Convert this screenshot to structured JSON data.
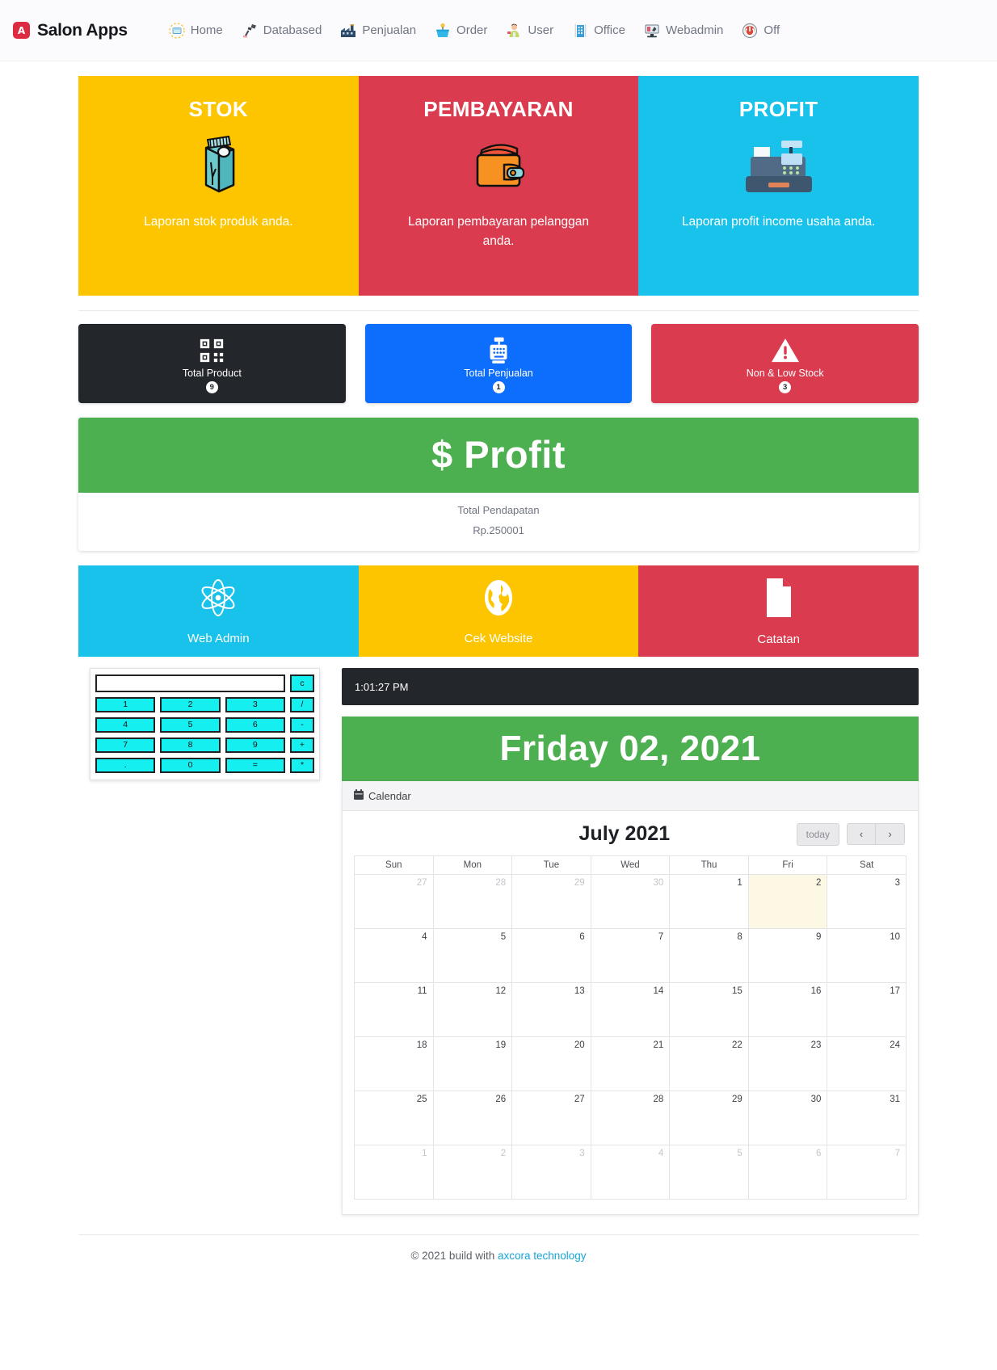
{
  "navbar": {
    "brand_initial": "A",
    "brand_name": "Salon Apps",
    "items": [
      {
        "label": "Home",
        "icon": "home-icon"
      },
      {
        "label": "Databased",
        "icon": "database-scanner-icon"
      },
      {
        "label": "Penjualan",
        "icon": "factory-icon"
      },
      {
        "label": "Order",
        "icon": "basket-icon"
      },
      {
        "label": "User",
        "icon": "user-icon"
      },
      {
        "label": "Office",
        "icon": "office-building-icon"
      },
      {
        "label": "Webadmin",
        "icon": "monitor-icon"
      },
      {
        "label": "Off",
        "icon": "power-off-icon"
      }
    ]
  },
  "hero_cards": [
    {
      "title": "STOK",
      "desc": "Laporan stok produk anda.",
      "color": "#fdc500",
      "icon": "milk-carton-icon"
    },
    {
      "title": "PEMBAYARAN",
      "desc": "Laporan pembayaran pelanggan anda.",
      "color": "#db3b4e",
      "icon": "wallet-icon"
    },
    {
      "title": "PROFIT",
      "desc": "Laporan profit income usaha anda.",
      "color": "#18c2ea",
      "icon": "cash-register-icon"
    }
  ],
  "stat_cards": [
    {
      "label": "Total Product",
      "count": "9",
      "color": "#23262b",
      "icon": "qr-code-icon"
    },
    {
      "label": "Total Penjualan",
      "count": "1",
      "color": "#0d6efd",
      "icon": "cash-register-icon"
    },
    {
      "label": "Non & Low Stock",
      "count": "3",
      "color": "#db3b4e",
      "icon": "warning-triangle-icon"
    }
  ],
  "profit": {
    "header": "$ Profit",
    "header_color": "#4caf50",
    "total_label": "Total Pendapatan",
    "total_value": "Rp.250001"
  },
  "action_cards": [
    {
      "label": "Web Admin",
      "color": "#18c2ea",
      "icon": "atom-icon"
    },
    {
      "label": "Cek Website",
      "color": "#fdc500",
      "icon": "globe-icon"
    },
    {
      "label": "Catatan",
      "color": "#db3b4e",
      "icon": "document-icon"
    }
  ],
  "calculator": {
    "display_value": "",
    "clear_label": "c",
    "keys": [
      [
        "1",
        "2",
        "3"
      ],
      [
        "4",
        "5",
        "6"
      ],
      [
        "7",
        "8",
        "9"
      ],
      [
        ".",
        "0",
        "="
      ]
    ],
    "operators": [
      "/",
      "-",
      "+",
      "*"
    ]
  },
  "clock": {
    "time": "1:01:27 PM"
  },
  "date_banner": {
    "text": "Friday 02, 2021",
    "color": "#4caf50"
  },
  "calendar_card": {
    "panel_title": "Calendar",
    "panel_icon": "calendar-icon",
    "month_title": "July 2021",
    "today_label": "today",
    "prev_label": "‹",
    "next_label": "›",
    "weekdays": [
      "Sun",
      "Mon",
      "Tue",
      "Wed",
      "Thu",
      "Fri",
      "Sat"
    ],
    "highlight_color": "#fcf8e3",
    "weeks": [
      [
        {
          "d": "27",
          "other": true
        },
        {
          "d": "28",
          "other": true
        },
        {
          "d": "29",
          "other": true
        },
        {
          "d": "30",
          "other": true
        },
        {
          "d": "1",
          "other": false
        },
        {
          "d": "2",
          "other": false,
          "today": true
        },
        {
          "d": "3",
          "other": false
        }
      ],
      [
        {
          "d": "4",
          "other": false
        },
        {
          "d": "5",
          "other": false
        },
        {
          "d": "6",
          "other": false
        },
        {
          "d": "7",
          "other": false
        },
        {
          "d": "8",
          "other": false
        },
        {
          "d": "9",
          "other": false
        },
        {
          "d": "10",
          "other": false
        }
      ],
      [
        {
          "d": "11",
          "other": false
        },
        {
          "d": "12",
          "other": false
        },
        {
          "d": "13",
          "other": false
        },
        {
          "d": "14",
          "other": false
        },
        {
          "d": "15",
          "other": false
        },
        {
          "d": "16",
          "other": false
        },
        {
          "d": "17",
          "other": false
        }
      ],
      [
        {
          "d": "18",
          "other": false
        },
        {
          "d": "19",
          "other": false
        },
        {
          "d": "20",
          "other": false
        },
        {
          "d": "21",
          "other": false
        },
        {
          "d": "22",
          "other": false
        },
        {
          "d": "23",
          "other": false
        },
        {
          "d": "24",
          "other": false
        }
      ],
      [
        {
          "d": "25",
          "other": false
        },
        {
          "d": "26",
          "other": false
        },
        {
          "d": "27",
          "other": false
        },
        {
          "d": "28",
          "other": false
        },
        {
          "d": "29",
          "other": false
        },
        {
          "d": "30",
          "other": false
        },
        {
          "d": "31",
          "other": false
        }
      ],
      [
        {
          "d": "1",
          "other": true
        },
        {
          "d": "2",
          "other": true
        },
        {
          "d": "3",
          "other": true
        },
        {
          "d": "4",
          "other": true
        },
        {
          "d": "5",
          "other": true
        },
        {
          "d": "6",
          "other": true
        },
        {
          "d": "7",
          "other": true
        }
      ]
    ]
  },
  "footer": {
    "text": "© 2021 build with ",
    "link": "axcora technology"
  }
}
